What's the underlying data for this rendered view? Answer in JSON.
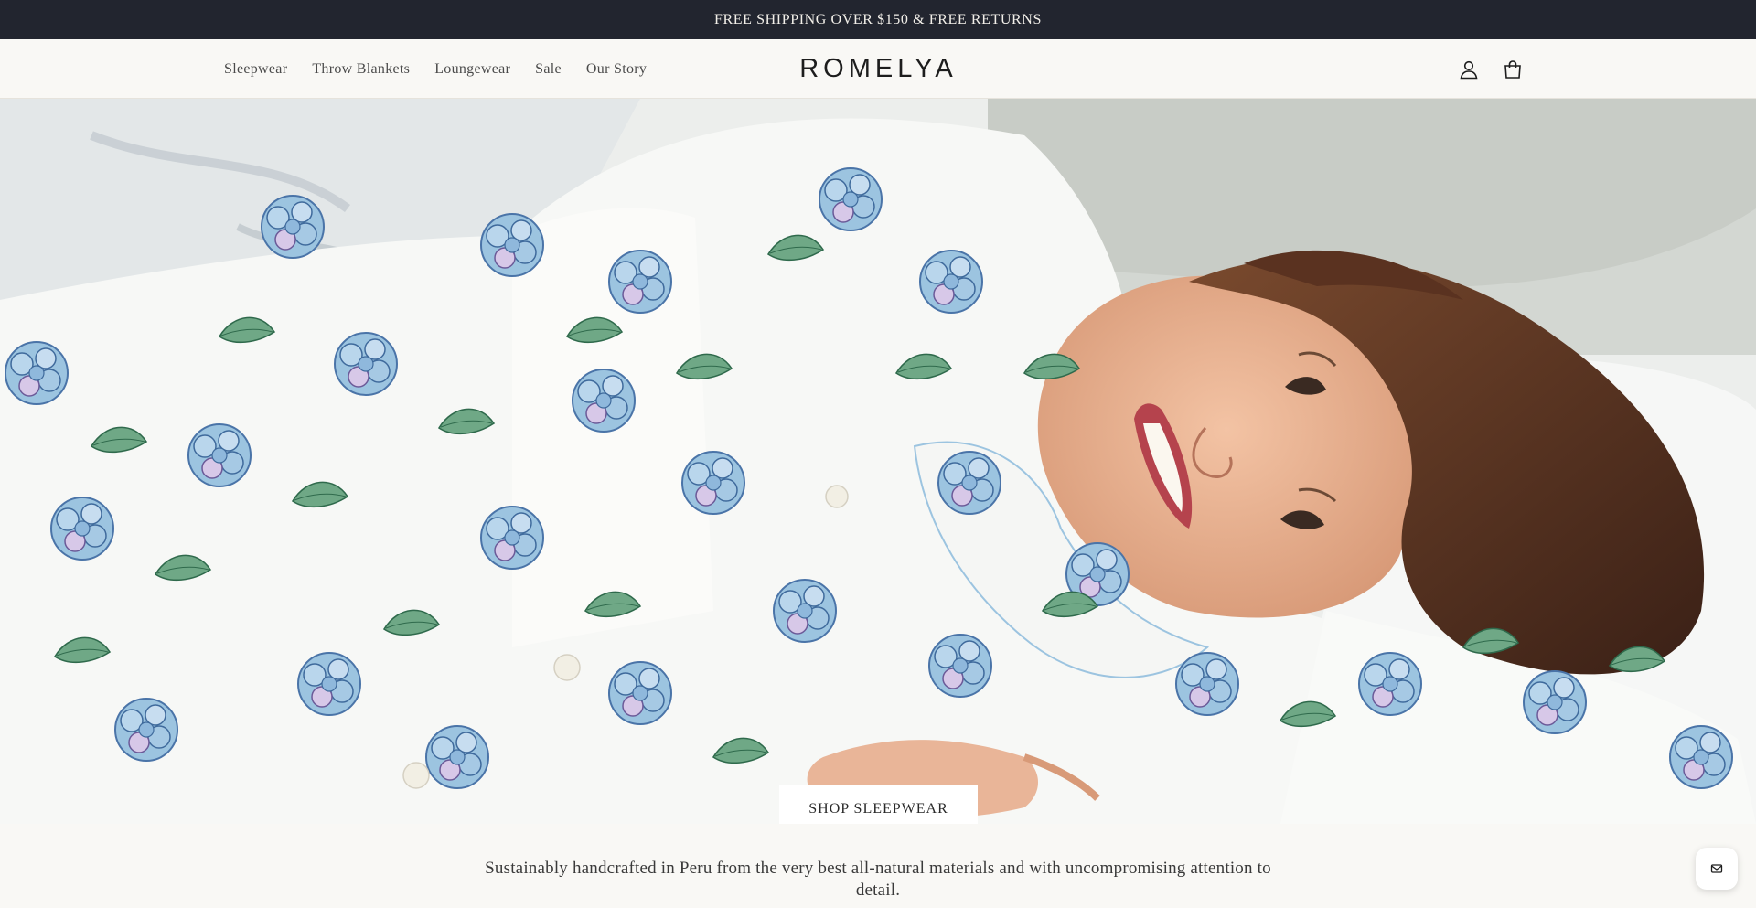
{
  "announcement": {
    "text": "FREE SHIPPING OVER $150 & FREE RETURNS"
  },
  "header": {
    "nav": [
      {
        "label": "Sleepwear"
      },
      {
        "label": "Throw Blankets"
      },
      {
        "label": "Loungewear"
      },
      {
        "label": "Sale"
      },
      {
        "label": "Our Story"
      }
    ],
    "logo": "ROMELYA",
    "icons": [
      "account-icon",
      "cart-icon"
    ]
  },
  "hero": {
    "cta_label": "SHOP SLEEPWEAR"
  },
  "tagline": "Sustainably handcrafted in Peru from the very best all-natural materials and with uncompromising attention to detail.",
  "chat": {
    "icon": "mail-icon"
  },
  "colors": {
    "announcement_bg": "#22252f",
    "page_bg": "#f9f8f5",
    "hydrangea_blue": "#8ab7d8",
    "leaf_green": "#5c9a78"
  }
}
